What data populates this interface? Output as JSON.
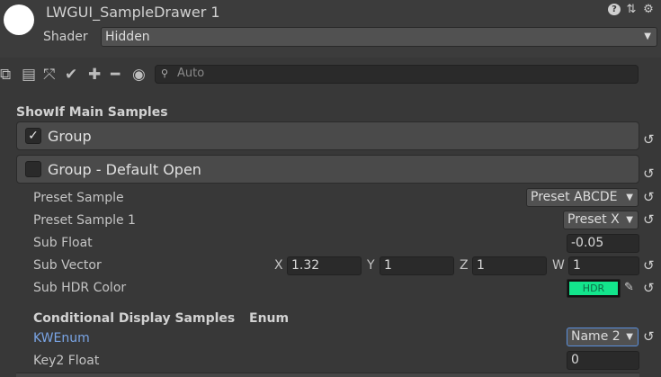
{
  "header": {
    "material_title": "LWGUI_SampleDrawer 1",
    "help_icon": "?",
    "shader_label": "Shader",
    "shader_value": "Hidden"
  },
  "toolbar": {
    "icons": [
      "copy-icon",
      "paste-icon",
      "collapse-icon",
      "check-icon",
      "plus-icon",
      "minus-icon",
      "eye-icon"
    ],
    "search_placeholder": "Auto"
  },
  "sections": {
    "showif_title": "ShowIf Main Samples",
    "group1_label": "Group",
    "group1_checked": true,
    "group2_label": "Group - Default Open",
    "group2_checked": false,
    "conditional_title": "Conditional Display Samples",
    "conditional_subtitle": "Enum"
  },
  "properties": {
    "preset_sample": {
      "label": "Preset Sample",
      "value": "Preset ABCDE"
    },
    "preset_sample_1": {
      "label": "Preset Sample 1",
      "value": "Preset X"
    },
    "sub_float": {
      "label": "Sub Float",
      "value": "-0.05"
    },
    "sub_vector": {
      "label": "Sub Vector",
      "x_label": "X",
      "x": "1.32",
      "y_label": "Y",
      "y": "1",
      "z_label": "Z",
      "z": "1",
      "w_label": "W",
      "w": "1"
    },
    "sub_hdr_color": {
      "label": "Sub HDR Color",
      "swatch_text": "HDR",
      "color": "#13e58c"
    },
    "kw_enum": {
      "label": "KWEnum",
      "value": "Name 2"
    },
    "key2_float": {
      "label": "Key2 Float",
      "value": "0"
    }
  },
  "colors": {
    "accent_link": "#7aa5e6",
    "background": "#383838"
  }
}
